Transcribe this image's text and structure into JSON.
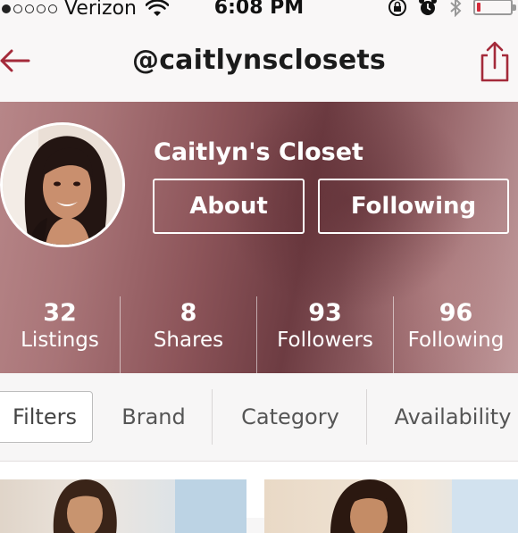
{
  "status_bar": {
    "carrier": "Verizon",
    "signal_bars_filled": 1,
    "signal_bars_total": 5,
    "time": "6:08 PM",
    "battery_level": 0.12,
    "battery_color": "#d42b3a"
  },
  "nav": {
    "title": "@caitlynsclosets",
    "back_icon": "back-arrow-icon",
    "share_icon": "share-icon",
    "accent_color": "#a42a3a"
  },
  "profile": {
    "name": "Caitlyn's Closet",
    "about_label": "About",
    "following_label": "Following"
  },
  "stats": [
    {
      "value": "32",
      "label": "Listings"
    },
    {
      "value": "8",
      "label": "Shares"
    },
    {
      "value": "93",
      "label": "Followers"
    },
    {
      "value": "96",
      "label": "Following"
    }
  ],
  "filters": {
    "filters_label": "Filters",
    "brand_label": "Brand",
    "category_label": "Category",
    "availability_label": "Availability"
  }
}
